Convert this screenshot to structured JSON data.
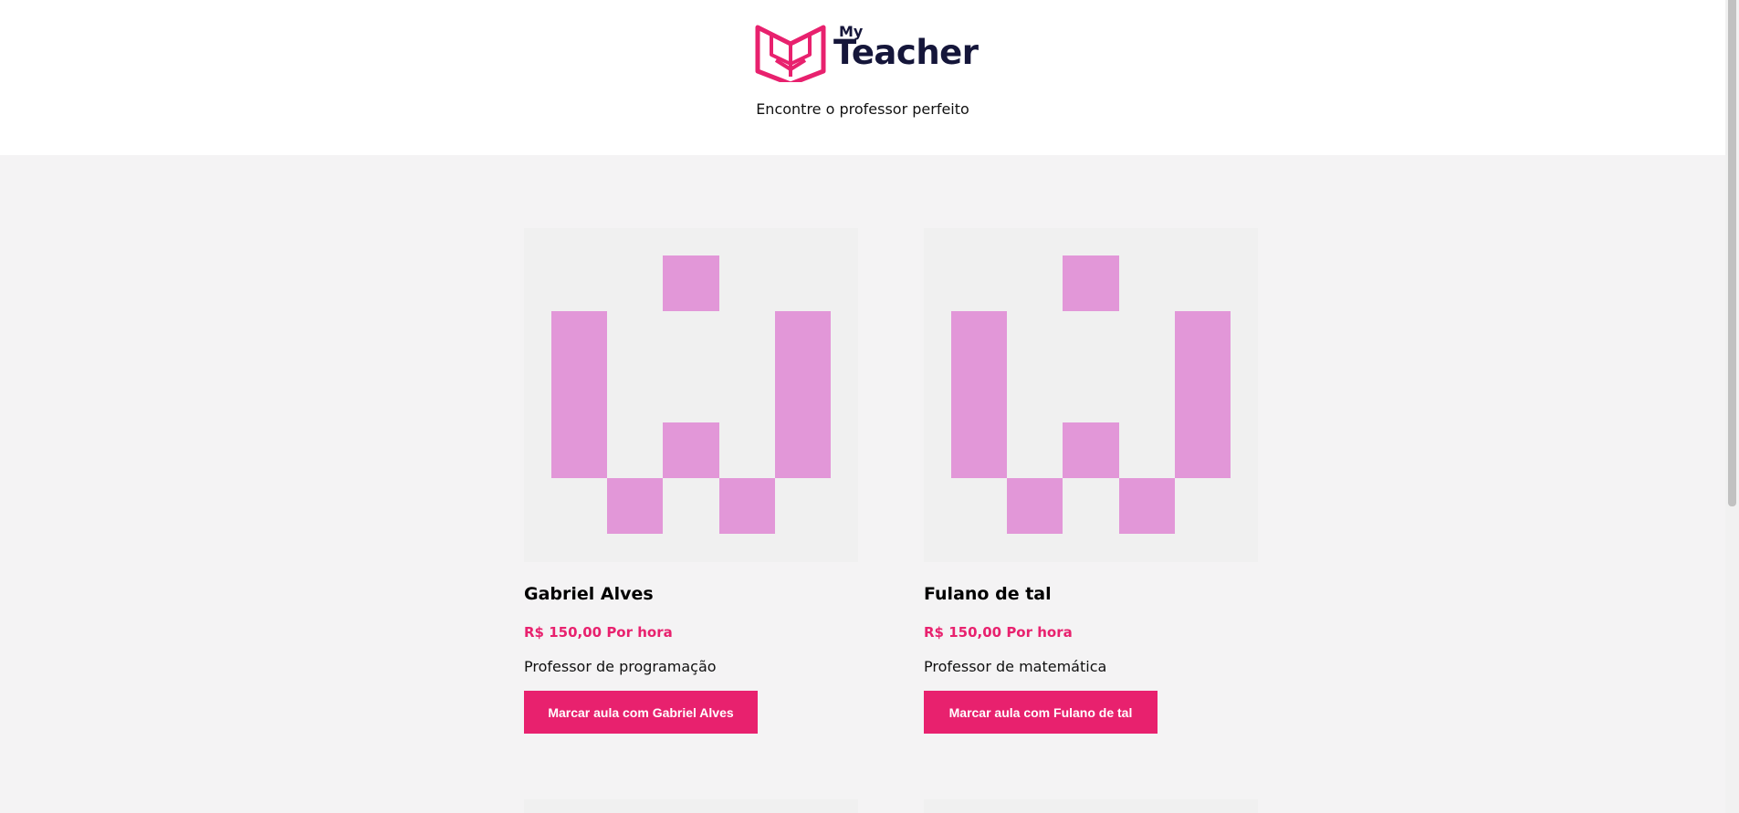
{
  "header": {
    "logo_my": "My",
    "logo_teacher": "Teacher",
    "tagline": "Encontre o professor perfeito"
  },
  "colors": {
    "brand_pink": "#e8216e",
    "avatar_pink": "#e297d8",
    "avatar_bg": "#f0f0f0",
    "page_bg": "#f4f3f4",
    "logo_navy": "#15163a"
  },
  "teachers": [
    {
      "name": "Gabriel Alves",
      "price": "R$ 150,00 Por hora",
      "description": "Professor de programação",
      "button_label": "Marcar aula com Gabriel Alves"
    },
    {
      "name": "Fulano de tal",
      "price": "R$ 150,00 Por hora",
      "description": "Professor de matemática",
      "button_label": "Marcar aula com Fulano de tal"
    }
  ]
}
